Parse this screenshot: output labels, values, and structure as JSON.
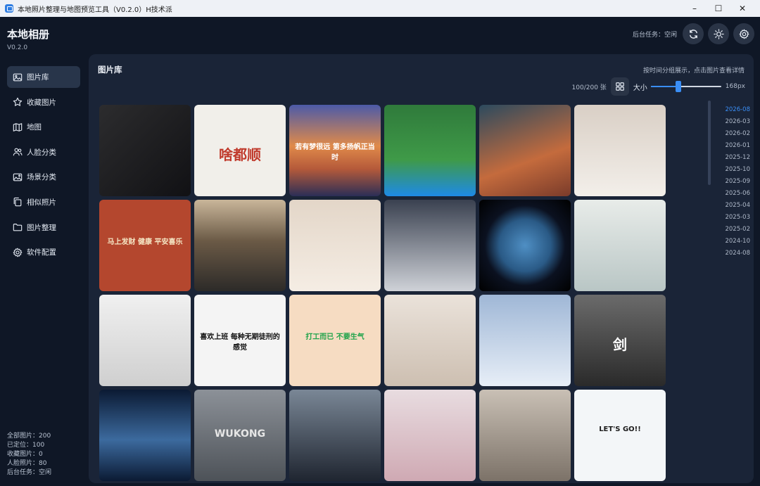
{
  "window": {
    "title": "本地照片整理与地图预览工具（V0.2.0）H技术派",
    "minimize": "–",
    "maximize": "☐",
    "close": "✕"
  },
  "header": {
    "title": "本地相册",
    "version": "V0.2.0",
    "bg_task": "后台任务：空闲",
    "buttons": [
      "refresh-icon",
      "sun-icon",
      "gear-icon"
    ]
  },
  "sidebar": {
    "items": [
      {
        "label": "图片库",
        "icon": "image-icon",
        "active": true
      },
      {
        "label": "收藏图片",
        "icon": "star-icon"
      },
      {
        "label": "地图",
        "icon": "map-icon"
      },
      {
        "label": "人脸分类",
        "icon": "people-icon"
      },
      {
        "label": "场景分类",
        "icon": "scene-icon"
      },
      {
        "label": "相似照片",
        "icon": "copy-icon"
      },
      {
        "label": "图片整理",
        "icon": "folder-icon"
      },
      {
        "label": "软件配置",
        "icon": "gear-icon"
      }
    ]
  },
  "stats": {
    "all": "全部图片：200",
    "located": "已定位：100",
    "favorites": "收藏图片：0",
    "faces": "人脸照片：80",
    "task": "后台任务：空闲"
  },
  "main": {
    "title": "图片库",
    "hint": "按时间分组展示，点击图片查看详情",
    "count": "100/200 张",
    "size_label": "大小",
    "size_value": "168px",
    "size_fraction": 0.38
  },
  "photos": [
    {
      "name": "world-map",
      "bg": "linear-gradient(135deg,#2c2c2e,#111114)"
    },
    {
      "name": "seal-calligraphy",
      "bg": "#f1efea",
      "text": "啥都顺",
      "color": "#c0392b"
    },
    {
      "name": "sunset-ocean-text",
      "bg": "linear-gradient(180deg,#4c5aa8 0%,#e08a4a 45%,#b55a3a 70%,#2b2e56 100%)",
      "text": "若有梦很远 第多扬帆正当时",
      "color": "#ffffff"
    },
    {
      "name": "white-flowers",
      "bg": "linear-gradient(180deg,#2f7a3b 0%,#3f9a48 60%,#1e8ae6 100%)"
    },
    {
      "name": "fantasy-dancer",
      "bg": "linear-gradient(160deg,#2c4a5e,#c46b3d 60%,#7a3b2a)"
    },
    {
      "name": "woman-bed",
      "bg": "linear-gradient(180deg,#d9cfc5,#f3efea)"
    },
    {
      "name": "red-couplet",
      "bg": "#b4472e",
      "text": "马上发财 健康 平安喜乐",
      "color": "#f5e7c5"
    },
    {
      "name": "highway-sunset",
      "bg": "linear-gradient(180deg,#c9b69a 0%,#6b5a46 45%,#2c2a28 100%)"
    },
    {
      "name": "woman-bedroom",
      "bg": "linear-gradient(180deg,#e3d6c8,#f5ede4)"
    },
    {
      "name": "woman-long-hair",
      "bg": "linear-gradient(180deg,#3a4150,#cfd2d8)"
    },
    {
      "name": "earth-planet",
      "bg": "radial-gradient(circle at 50% 50%,#4f8fc4 0%,#2a5a86 40%,#0b1120 62%,#000 100%)"
    },
    {
      "name": "misty-temple",
      "bg": "linear-gradient(180deg,#e8ece9,#b9c6c5)"
    },
    {
      "name": "ink-mountain",
      "bg": "linear-gradient(180deg,#f0f0f0,#cfcfcf)"
    },
    {
      "name": "text-banner",
      "bg": "#f4f4f4",
      "text": "喜欢上班 每种无期徒刑的感觉",
      "color": "#111111"
    },
    {
      "name": "green-text",
      "bg": "#f6dcc2",
      "text": "打工而已 不要生气",
      "color": "#1fa34a"
    },
    {
      "name": "woman-sofa",
      "bg": "linear-gradient(180deg,#eae2da,#cdbfb1)"
    },
    {
      "name": "white-hair-warrior",
      "bg": "linear-gradient(180deg,#9fb7d6,#e7eef7)"
    },
    {
      "name": "ink-swordsman",
      "bg": "linear-gradient(180deg,#6b6b6b,#2a2a2a)",
      "text": "剑",
      "color": "#ffffff"
    },
    {
      "name": "blue-planet-sky",
      "bg": "linear-gradient(180deg,#0b1a33,#3c6a9e 55%,#0b1a33)"
    },
    {
      "name": "wukong-poster",
      "bg": "linear-gradient(180deg,#8c9198,#4d5258)",
      "text": "WUKONG",
      "color": "#e6e6e6"
    },
    {
      "name": "swordsman-portrait",
      "bg": "linear-gradient(180deg,#7a8796,#1f2530)"
    },
    {
      "name": "pink-fairy",
      "bg": "linear-gradient(180deg,#e8dce0,#cfa9b3)"
    },
    {
      "name": "anime-girl-newspaper",
      "bg": "linear-gradient(180deg,#c9c0b5,#7c7268)"
    },
    {
      "name": "lets-go-cats",
      "bg": "#f3f6f8",
      "text": "LET'S GO!!",
      "color": "#1b1b1b"
    }
  ],
  "timeline": {
    "items": [
      "2026-08",
      "2026-03",
      "2026-02",
      "2026-01",
      "2025-12",
      "2025-10",
      "2025-09",
      "2025-06",
      "2025-04",
      "2025-03",
      "2025-02",
      "2024-10",
      "2024-08"
    ],
    "active_index": 0
  }
}
